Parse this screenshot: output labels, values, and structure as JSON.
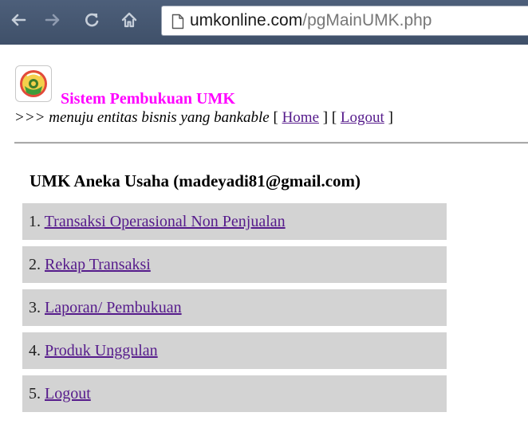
{
  "browser": {
    "url_host": "umkonline.com",
    "url_path": "/pgMainUMK.php"
  },
  "header": {
    "site_title": "Sistem Pembukuan UMK",
    "tagline_prefix": ">>>",
    "tagline": "menuju entitas bisnis yang bankable",
    "home_label": "Home",
    "logout_label": "Logout"
  },
  "main": {
    "org_label": "UMK Aneka Usaha (madeyadi81@gmail.com)",
    "menu": [
      {
        "number": "1.",
        "label": "Transaksi Operasional Non Penjualan"
      },
      {
        "number": "2.",
        "label": "Rekap Transaksi"
      },
      {
        "number": "3.",
        "label": "Laporan/ Pembukuan"
      },
      {
        "number": "4.",
        "label": "Produk Unggulan"
      },
      {
        "number": "5.",
        "label": "Logout"
      }
    ]
  },
  "colors": {
    "title": "#ff00ff",
    "link": "#551a8b",
    "menu_bg": "#d3d3d3",
    "toolbar_bg": "#4d5f7a"
  },
  "icons": [
    "back-arrow-icon",
    "forward-arrow-icon",
    "reload-icon",
    "home-icon",
    "page-icon",
    "umk-logo-icon"
  ]
}
